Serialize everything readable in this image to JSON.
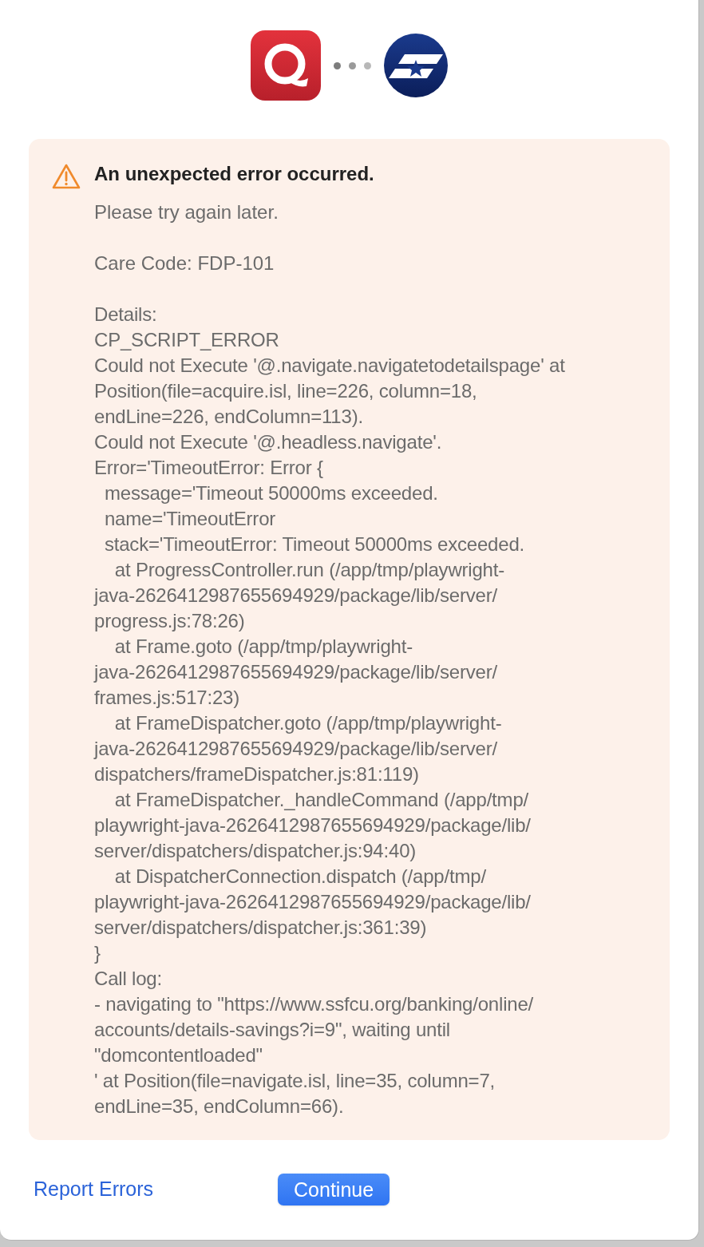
{
  "error": {
    "title": "An unexpected error occurred.",
    "subtitle": "Please try again later.",
    "care_code": "Care Code: FDP-101",
    "details_lines": [
      "Details:",
      "CP_SCRIPT_ERROR",
      "Could not Execute '@.navigate.navigatetodetailspage' at",
      "Position(file=acquire.isl, line=226, column=18,",
      "endLine=226, endColumn=113).",
      "Could not Execute '@.headless.navigate'.",
      "Error='TimeoutError: Error {",
      "  message='Timeout 50000ms exceeded.",
      "  name='TimeoutError",
      "  stack='TimeoutError: Timeout 50000ms exceeded.",
      "    at ProgressController.run (/app/tmp/playwright-",
      "java-2626412987655694929/package/lib/server/",
      "progress.js:78:26)",
      "    at Frame.goto (/app/tmp/playwright-",
      "java-2626412987655694929/package/lib/server/",
      "frames.js:517:23)",
      "    at FrameDispatcher.goto (/app/tmp/playwright-",
      "java-2626412987655694929/package/lib/server/",
      "dispatchers/frameDispatcher.js:81:119)",
      "    at FrameDispatcher._handleCommand (/app/tmp/",
      "playwright-java-2626412987655694929/package/lib/",
      "server/dispatchers/dispatcher.js:94:40)",
      "    at DispatcherConnection.dispatch (/app/tmp/",
      "playwright-java-2626412987655694929/package/lib/",
      "server/dispatchers/dispatcher.js:361:39)",
      "}",
      "Call log:",
      "- navigating to \"https://www.ssfcu.org/banking/online/",
      "accounts/details-savings?i=9\", waiting until",
      "\"domcontentloaded\"",
      "' at Position(file=navigate.isl, line=35, column=7,",
      "endLine=35, endColumn=66)."
    ]
  },
  "footer": {
    "link": "Report Errors",
    "button": "Continue"
  }
}
